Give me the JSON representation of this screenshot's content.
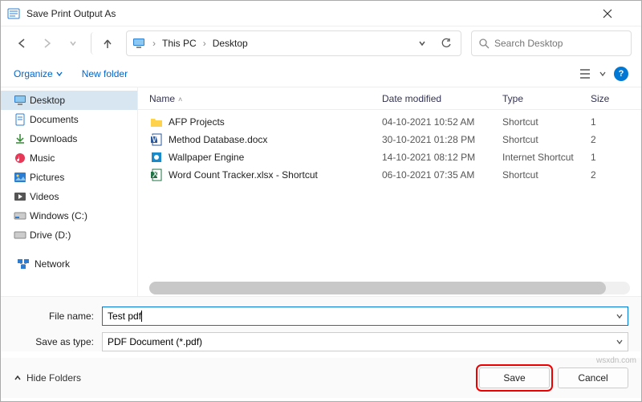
{
  "titlebar": {
    "title": "Save Print Output As"
  },
  "breadcrumb": {
    "root": "This PC",
    "current": "Desktop"
  },
  "search": {
    "placeholder": "Search Desktop"
  },
  "toolbar": {
    "organize": "Organize",
    "newfolder": "New folder"
  },
  "sidebar": {
    "items": [
      {
        "label": "Desktop"
      },
      {
        "label": "Documents"
      },
      {
        "label": "Downloads"
      },
      {
        "label": "Music"
      },
      {
        "label": "Pictures"
      },
      {
        "label": "Videos"
      },
      {
        "label": "Windows (C:)"
      },
      {
        "label": "Drive (D:)"
      }
    ],
    "network": "Network"
  },
  "columns": {
    "name": "Name",
    "date": "Date modified",
    "type": "Type",
    "size": "Size"
  },
  "files": [
    {
      "name": "AFP Projects",
      "date": "04-10-2021 10:52 AM",
      "type": "Shortcut",
      "size": "1"
    },
    {
      "name": "Method Database.docx",
      "date": "30-10-2021 01:28 PM",
      "type": "Shortcut",
      "size": "2"
    },
    {
      "name": "Wallpaper Engine",
      "date": "14-10-2021 08:12 PM",
      "type": "Internet Shortcut",
      "size": "1"
    },
    {
      "name": "Word Count Tracker.xlsx - Shortcut",
      "date": "06-10-2021 07:35 AM",
      "type": "Shortcut",
      "size": "2"
    }
  ],
  "form": {
    "filename_label": "File name:",
    "filename_value": "Test pdf",
    "type_label": "Save as type:",
    "type_value": "PDF Document (*.pdf)"
  },
  "buttons": {
    "hide": "Hide Folders",
    "save": "Save",
    "cancel": "Cancel"
  },
  "watermark": "wsxdn.com"
}
